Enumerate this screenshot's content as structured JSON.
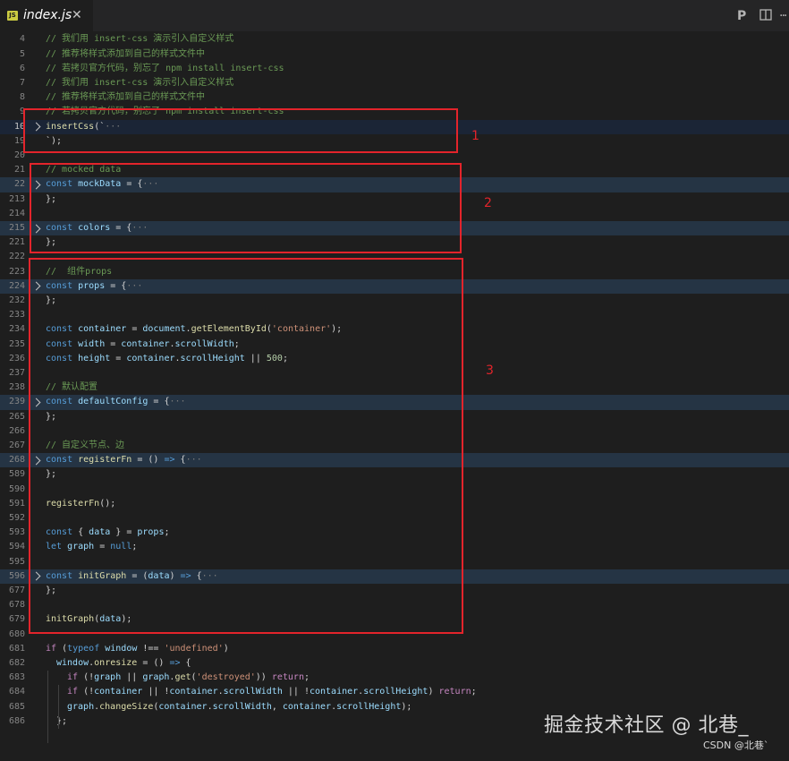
{
  "tab": {
    "file_name": "index.js",
    "file_badge": "JS",
    "close_glyph": "✕"
  },
  "toolbar": {
    "preview_glyph": "P",
    "split_glyph": "▯▯",
    "more_glyph": "···"
  },
  "lines": [
    {
      "num": "4",
      "tokens": [
        [
          "cm",
          "// 我们用 insert-css 演示引入自定义样式"
        ]
      ]
    },
    {
      "num": "5",
      "tokens": [
        [
          "cm",
          "// 推荐将样式添加到自己的样式文件中"
        ]
      ]
    },
    {
      "num": "6",
      "tokens": [
        [
          "cm",
          "// 若拷贝官方代码，别忘了 npm install insert-css"
        ]
      ]
    },
    {
      "num": "7",
      "tokens": [
        [
          "cm",
          "// 我们用 insert-css 演示引入自定义样式"
        ]
      ]
    },
    {
      "num": "8",
      "tokens": [
        [
          "cm",
          "// 推荐将样式添加到自己的样式文件中"
        ]
      ]
    },
    {
      "num": "9",
      "tokens": [
        [
          "cm",
          "// 若拷贝官方代码，别忘了 npm install insert-css"
        ]
      ]
    },
    {
      "num": "10",
      "active": true,
      "fold": true,
      "hl": "cur",
      "tokens": [
        [
          "fn",
          "insertCss"
        ],
        [
          "pl",
          "(`"
        ],
        [
          "ds",
          "···"
        ]
      ]
    },
    {
      "num": "19",
      "tokens": [
        [
          "pl",
          "`);"
        ]
      ]
    },
    {
      "num": "20",
      "tokens": []
    },
    {
      "num": "21",
      "tokens": [
        [
          "cm",
          "// mocked data"
        ]
      ]
    },
    {
      "num": "22",
      "fold": true,
      "hl": "hl",
      "tokens": [
        [
          "kw",
          "const "
        ],
        [
          "vr",
          "mockData"
        ],
        [
          "pl",
          " = {"
        ],
        [
          "ds",
          "···"
        ]
      ]
    },
    {
      "num": "213",
      "tokens": [
        [
          "pl",
          "};"
        ]
      ]
    },
    {
      "num": "214",
      "tokens": []
    },
    {
      "num": "215",
      "fold": true,
      "hl": "hl",
      "tokens": [
        [
          "kw",
          "const "
        ],
        [
          "vr",
          "colors"
        ],
        [
          "pl",
          " = {"
        ],
        [
          "ds",
          "···"
        ]
      ]
    },
    {
      "num": "221",
      "tokens": [
        [
          "pl",
          "};"
        ]
      ]
    },
    {
      "num": "222",
      "tokens": []
    },
    {
      "num": "223",
      "tokens": [
        [
          "cm",
          "//  组件props"
        ]
      ]
    },
    {
      "num": "224",
      "fold": true,
      "hl": "hl",
      "tokens": [
        [
          "kw",
          "const "
        ],
        [
          "vr",
          "props"
        ],
        [
          "pl",
          " = {"
        ],
        [
          "ds",
          "···"
        ]
      ]
    },
    {
      "num": "232",
      "tokens": [
        [
          "pl",
          "};"
        ]
      ]
    },
    {
      "num": "233",
      "tokens": []
    },
    {
      "num": "234",
      "tokens": [
        [
          "kw",
          "const "
        ],
        [
          "vr",
          "container"
        ],
        [
          "pl",
          " = "
        ],
        [
          "vr",
          "document"
        ],
        [
          "pl",
          "."
        ],
        [
          "fn",
          "getElementById"
        ],
        [
          "pl",
          "("
        ],
        [
          "st",
          "'container'"
        ],
        [
          "pl",
          ");"
        ]
      ]
    },
    {
      "num": "235",
      "tokens": [
        [
          "kw",
          "const "
        ],
        [
          "vr",
          "width"
        ],
        [
          "pl",
          " = "
        ],
        [
          "vr",
          "container"
        ],
        [
          "pl",
          "."
        ],
        [
          "vr",
          "scrollWidth"
        ],
        [
          "pl",
          ";"
        ]
      ]
    },
    {
      "num": "236",
      "tokens": [
        [
          "kw",
          "const "
        ],
        [
          "vr",
          "height"
        ],
        [
          "pl",
          " = "
        ],
        [
          "vr",
          "container"
        ],
        [
          "pl",
          "."
        ],
        [
          "vr",
          "scrollHeight"
        ],
        [
          "pl",
          " || "
        ],
        [
          "nm",
          "500"
        ],
        [
          "pl",
          ";"
        ]
      ]
    },
    {
      "num": "237",
      "tokens": []
    },
    {
      "num": "238",
      "tokens": [
        [
          "cm",
          "// 默认配置"
        ]
      ]
    },
    {
      "num": "239",
      "fold": true,
      "hl": "hl",
      "tokens": [
        [
          "kw",
          "const "
        ],
        [
          "vr",
          "defaultConfig"
        ],
        [
          "pl",
          " = {"
        ],
        [
          "ds",
          "···"
        ]
      ]
    },
    {
      "num": "265",
      "tokens": [
        [
          "pl",
          "};"
        ]
      ]
    },
    {
      "num": "266",
      "tokens": []
    },
    {
      "num": "267",
      "tokens": [
        [
          "cm",
          "// 自定义节点、边"
        ]
      ]
    },
    {
      "num": "268",
      "fold": true,
      "hl": "hl",
      "tokens": [
        [
          "kw",
          "const "
        ],
        [
          "fn",
          "registerFn"
        ],
        [
          "pl",
          " = () "
        ],
        [
          "kw",
          "=>"
        ],
        [
          "pl",
          " {"
        ],
        [
          "ds",
          "···"
        ]
      ]
    },
    {
      "num": "589",
      "tokens": [
        [
          "pl",
          "};"
        ]
      ]
    },
    {
      "num": "590",
      "tokens": []
    },
    {
      "num": "591",
      "tokens": [
        [
          "fn",
          "registerFn"
        ],
        [
          "pl",
          "();"
        ]
      ]
    },
    {
      "num": "592",
      "tokens": []
    },
    {
      "num": "593",
      "tokens": [
        [
          "kw",
          "const "
        ],
        [
          "pl",
          "{ "
        ],
        [
          "vr",
          "data"
        ],
        [
          "pl",
          " } = "
        ],
        [
          "vr",
          "props"
        ],
        [
          "pl",
          ";"
        ]
      ]
    },
    {
      "num": "594",
      "tokens": [
        [
          "kw",
          "let "
        ],
        [
          "vr",
          "graph"
        ],
        [
          "pl",
          " = "
        ],
        [
          "kw",
          "null"
        ],
        [
          "pl",
          ";"
        ]
      ]
    },
    {
      "num": "595",
      "tokens": []
    },
    {
      "num": "596",
      "fold": true,
      "hl": "hl",
      "tokens": [
        [
          "kw",
          "const "
        ],
        [
          "fn",
          "initGraph"
        ],
        [
          "pl",
          " = ("
        ],
        [
          "vr",
          "data"
        ],
        [
          "pl",
          ") "
        ],
        [
          "kw",
          "=>"
        ],
        [
          "pl",
          " {"
        ],
        [
          "ds",
          "···"
        ]
      ]
    },
    {
      "num": "677",
      "tokens": [
        [
          "pl",
          "};"
        ]
      ]
    },
    {
      "num": "678",
      "tokens": []
    },
    {
      "num": "679",
      "tokens": [
        [
          "fn",
          "initGraph"
        ],
        [
          "pl",
          "("
        ],
        [
          "vr",
          "data"
        ],
        [
          "pl",
          ");"
        ]
      ]
    },
    {
      "num": "680",
      "tokens": []
    },
    {
      "num": "681",
      "tokens": [
        [
          "ct",
          "if"
        ],
        [
          "pl",
          " ("
        ],
        [
          "kw",
          "typeof "
        ],
        [
          "vr",
          "window"
        ],
        [
          "pl",
          " !== "
        ],
        [
          "st",
          "'undefined'"
        ],
        [
          "pl",
          ")"
        ]
      ]
    },
    {
      "num": "682",
      "indent": 1,
      "tokens": [
        [
          "vr",
          "window"
        ],
        [
          "pl",
          "."
        ],
        [
          "fn",
          "onresize"
        ],
        [
          "pl",
          " = () "
        ],
        [
          "kw",
          "=>"
        ],
        [
          "pl",
          " {"
        ]
      ]
    },
    {
      "num": "683",
      "indent": 2,
      "tokens": [
        [
          "ct",
          "if"
        ],
        [
          "pl",
          " (!"
        ],
        [
          "vr",
          "graph"
        ],
        [
          "pl",
          " || "
        ],
        [
          "vr",
          "graph"
        ],
        [
          "pl",
          "."
        ],
        [
          "fn",
          "get"
        ],
        [
          "pl",
          "("
        ],
        [
          "st",
          "'destroyed'"
        ],
        [
          "pl",
          ")) "
        ],
        [
          "ct",
          "return"
        ],
        [
          "pl",
          ";"
        ]
      ]
    },
    {
      "num": "684",
      "indent": 2,
      "tokens": [
        [
          "ct",
          "if"
        ],
        [
          "pl",
          " (!"
        ],
        [
          "vr",
          "container"
        ],
        [
          "pl",
          " || !"
        ],
        [
          "vr",
          "container"
        ],
        [
          "pl",
          "."
        ],
        [
          "vr",
          "scrollWidth"
        ],
        [
          "pl",
          " || !"
        ],
        [
          "vr",
          "container"
        ],
        [
          "pl",
          "."
        ],
        [
          "vr",
          "scrollHeight"
        ],
        [
          "pl",
          ") "
        ],
        [
          "ct",
          "return"
        ],
        [
          "pl",
          ";"
        ]
      ]
    },
    {
      "num": "685",
      "indent": 2,
      "tokens": [
        [
          "vr",
          "graph"
        ],
        [
          "pl",
          "."
        ],
        [
          "fn",
          "changeSize"
        ],
        [
          "pl",
          "("
        ],
        [
          "vr",
          "container"
        ],
        [
          "pl",
          "."
        ],
        [
          "vr",
          "scrollWidth"
        ],
        [
          "pl",
          ", "
        ],
        [
          "vr",
          "container"
        ],
        [
          "pl",
          "."
        ],
        [
          "vr",
          "scrollHeight"
        ],
        [
          "pl",
          ");"
        ]
      ]
    },
    {
      "num": "686",
      "indent": 1,
      "tokens": [
        [
          "pl",
          "};"
        ]
      ]
    },
    {
      "num": "",
      "tokens": []
    }
  ],
  "annotations": [
    {
      "label": "1"
    },
    {
      "label": "2"
    },
    {
      "label": "3"
    }
  ],
  "watermark": {
    "main": "掘金技术社区 @ 北巷_",
    "sub": "CSDN @北巷`"
  }
}
